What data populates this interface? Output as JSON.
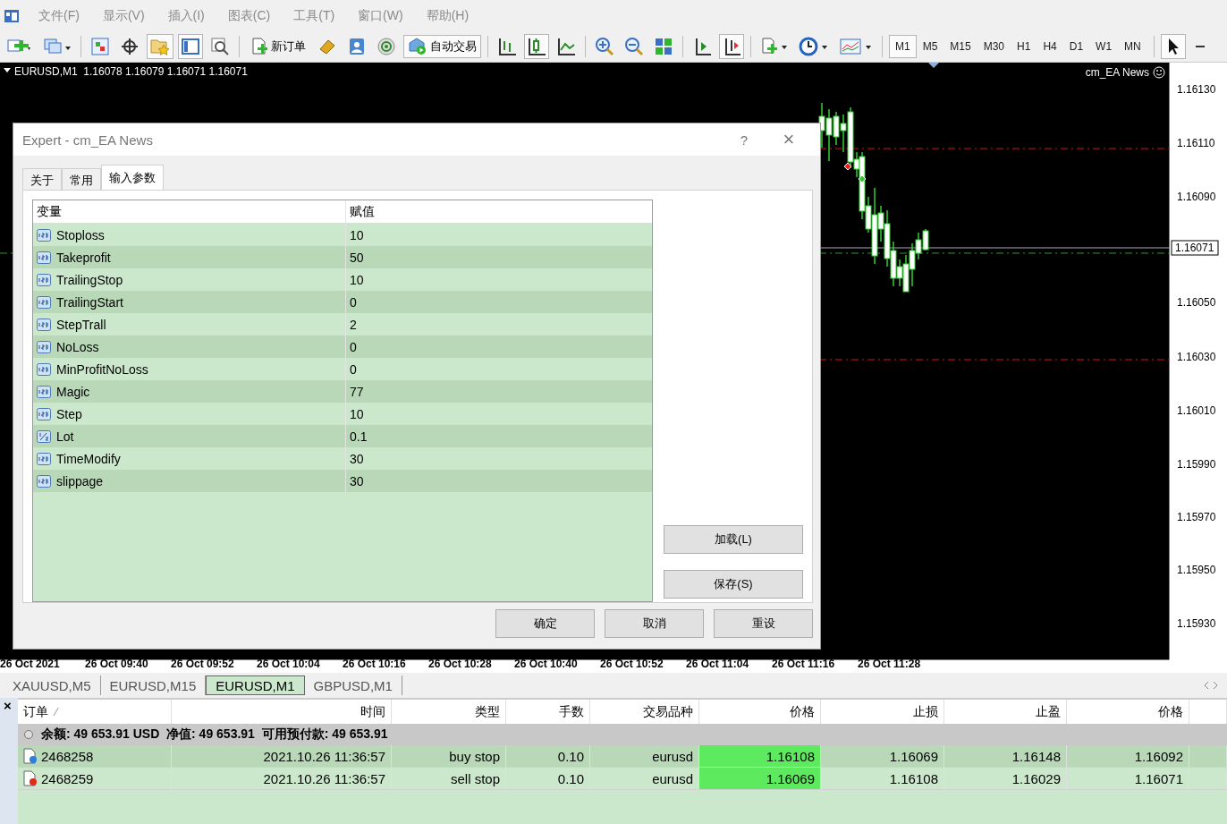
{
  "menu": [
    "文件(F)",
    "显示(V)",
    "插入(I)",
    "图表(C)",
    "工具(T)",
    "窗口(W)",
    "帮助(H)"
  ],
  "toolbar": {
    "new_order": "新订单",
    "auto_trading": {
      "label": "自动交易",
      "on": true
    },
    "timeframes": [
      {
        "label": "M1",
        "selected": true
      },
      {
        "label": "M5",
        "selected": false
      },
      {
        "label": "M15",
        "selected": false
      },
      {
        "label": "M30",
        "selected": false
      },
      {
        "label": "H1",
        "selected": false
      },
      {
        "label": "H4",
        "selected": false
      },
      {
        "label": "D1",
        "selected": false
      },
      {
        "label": "W1",
        "selected": false
      },
      {
        "label": "MN",
        "selected": false
      }
    ]
  },
  "chart": {
    "header": "EURUSD,M1  1.16078 1.16079 1.16071 1.16071",
    "expert": "cm_EA News",
    "price_labels": [
      "1.16130",
      "1.16110",
      "1.16090",
      "1.16050",
      "1.16030",
      "1.16010",
      "1.15990",
      "1.15970",
      "1.15950",
      "1.15930"
    ],
    "current_price": "1.16071",
    "time_labels": [
      "26 Oct 2021",
      "26 Oct 09:40",
      "26 Oct 09:52",
      "26 Oct 10:04",
      "26 Oct 10:16",
      "26 Oct 10:28",
      "26 Oct 10:40",
      "26 Oct 10:52",
      "26 Oct 11:04",
      "26 Oct 11:16",
      "26 Oct 11:28"
    ]
  },
  "dialog": {
    "title": "Expert - cm_EA News",
    "help": "?",
    "close": "×",
    "tabs": [
      {
        "label": "关于",
        "selected": false
      },
      {
        "label": "常用",
        "selected": false
      },
      {
        "label": "输入参数",
        "selected": true
      }
    ],
    "columns": [
      "变量",
      "赋值"
    ],
    "params": [
      {
        "kind": "int",
        "name": "Stoploss",
        "value": "10"
      },
      {
        "kind": "int",
        "name": "Takeprofit",
        "value": "50"
      },
      {
        "kind": "int",
        "name": "TrailingStop",
        "value": "10"
      },
      {
        "kind": "int",
        "name": "TrailingStart",
        "value": "0"
      },
      {
        "kind": "int",
        "name": "StepTrall",
        "value": "2"
      },
      {
        "kind": "int",
        "name": "NoLoss",
        "value": "0"
      },
      {
        "kind": "int",
        "name": "MinProfitNoLoss",
        "value": "0"
      },
      {
        "kind": "int",
        "name": "Magic",
        "value": "77"
      },
      {
        "kind": "int",
        "name": "Step",
        "value": "10"
      },
      {
        "kind": "double",
        "name": "Lot",
        "value": "0.1"
      },
      {
        "kind": "int",
        "name": "TimeModify",
        "value": "30"
      },
      {
        "kind": "int",
        "name": "slippage",
        "value": "30"
      }
    ],
    "side_buttons": [
      "加载(L)",
      "保存(S)"
    ],
    "buttons": [
      "确定",
      "取消",
      "重设"
    ]
  },
  "chart_tabs": [
    {
      "label": "XAUUSD,M5",
      "selected": false
    },
    {
      "label": "EURUSD,M15",
      "selected": false
    },
    {
      "label": "EURUSD,M1",
      "selected": true
    },
    {
      "label": "GBPUSD,M1",
      "selected": false
    }
  ],
  "terminal": {
    "close": "×",
    "columns": [
      "订单",
      "时间",
      "类型",
      "手数",
      "交易品种",
      "价格",
      "止损",
      "止盈",
      "价格"
    ],
    "sort_mark": "⁄",
    "summary": "余额: 49 653.91 USD  净值: 49 653.91  可用预付款: 49 653.91",
    "orders": [
      {
        "kind": "buy",
        "cells": [
          "2468258",
          "2021.10.26 11:36:57",
          "buy stop",
          "0.10",
          "eurusd",
          "1.16108",
          "1.16069",
          "1.16148",
          "1.16092"
        ]
      },
      {
        "kind": "sell",
        "cells": [
          "2468259",
          "2021.10.26 11:36:57",
          "sell stop",
          "0.10",
          "eurusd",
          "1.16069",
          "1.16108",
          "1.16029",
          "1.16071"
        ]
      }
    ]
  }
}
